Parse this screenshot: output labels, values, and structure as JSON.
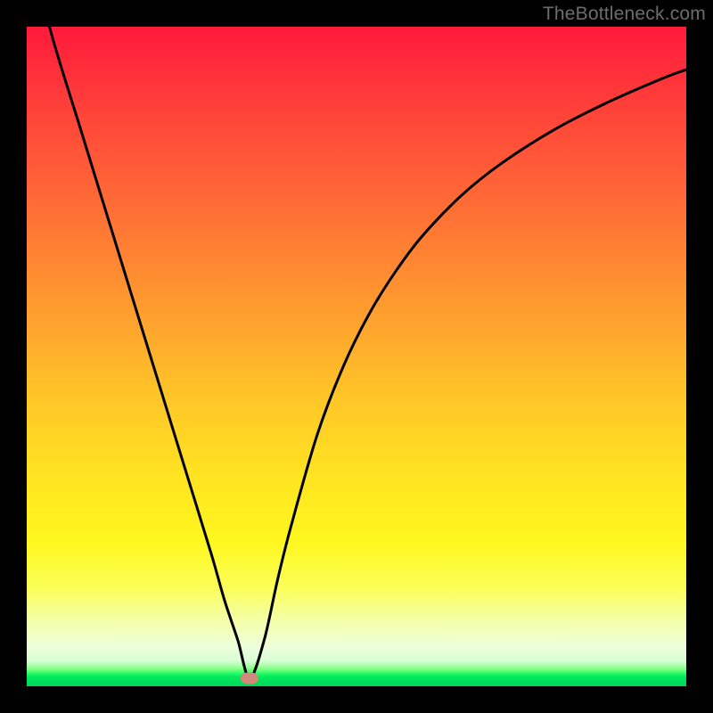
{
  "watermark": "TheBottleneck.com",
  "chart_data": {
    "type": "line",
    "title": "",
    "xlabel": "",
    "ylabel": "",
    "xlim": [
      0,
      100
    ],
    "ylim": [
      0,
      100
    ],
    "grid": false,
    "legend": false,
    "background": "gradient-red-yellow-green-vertical",
    "series": [
      {
        "name": "bottleneck-curve",
        "x": [
          0,
          4,
          8,
          12,
          16,
          20,
          24,
          28,
          30,
          32,
          33.8,
          36,
          38,
          40,
          44,
          48,
          52,
          56,
          60,
          66,
          72,
          80,
          88,
          96,
          100
        ],
        "y": [
          113,
          98,
          85,
          72,
          59,
          46,
          33,
          20,
          13,
          7,
          1.2,
          7,
          16,
          24,
          38,
          48.5,
          56.6,
          63,
          68.3,
          74.5,
          79.3,
          84.4,
          88.5,
          92,
          93.5
        ]
      }
    ],
    "marker": {
      "x": 33.8,
      "y": 1.2,
      "color": "#d18a7a"
    },
    "colors": {
      "curve": "#000000",
      "frame": "#000000",
      "gradient_top": "#ff1a3c",
      "gradient_mid": "#ffe321",
      "gradient_bottom": "#00d85a"
    }
  }
}
